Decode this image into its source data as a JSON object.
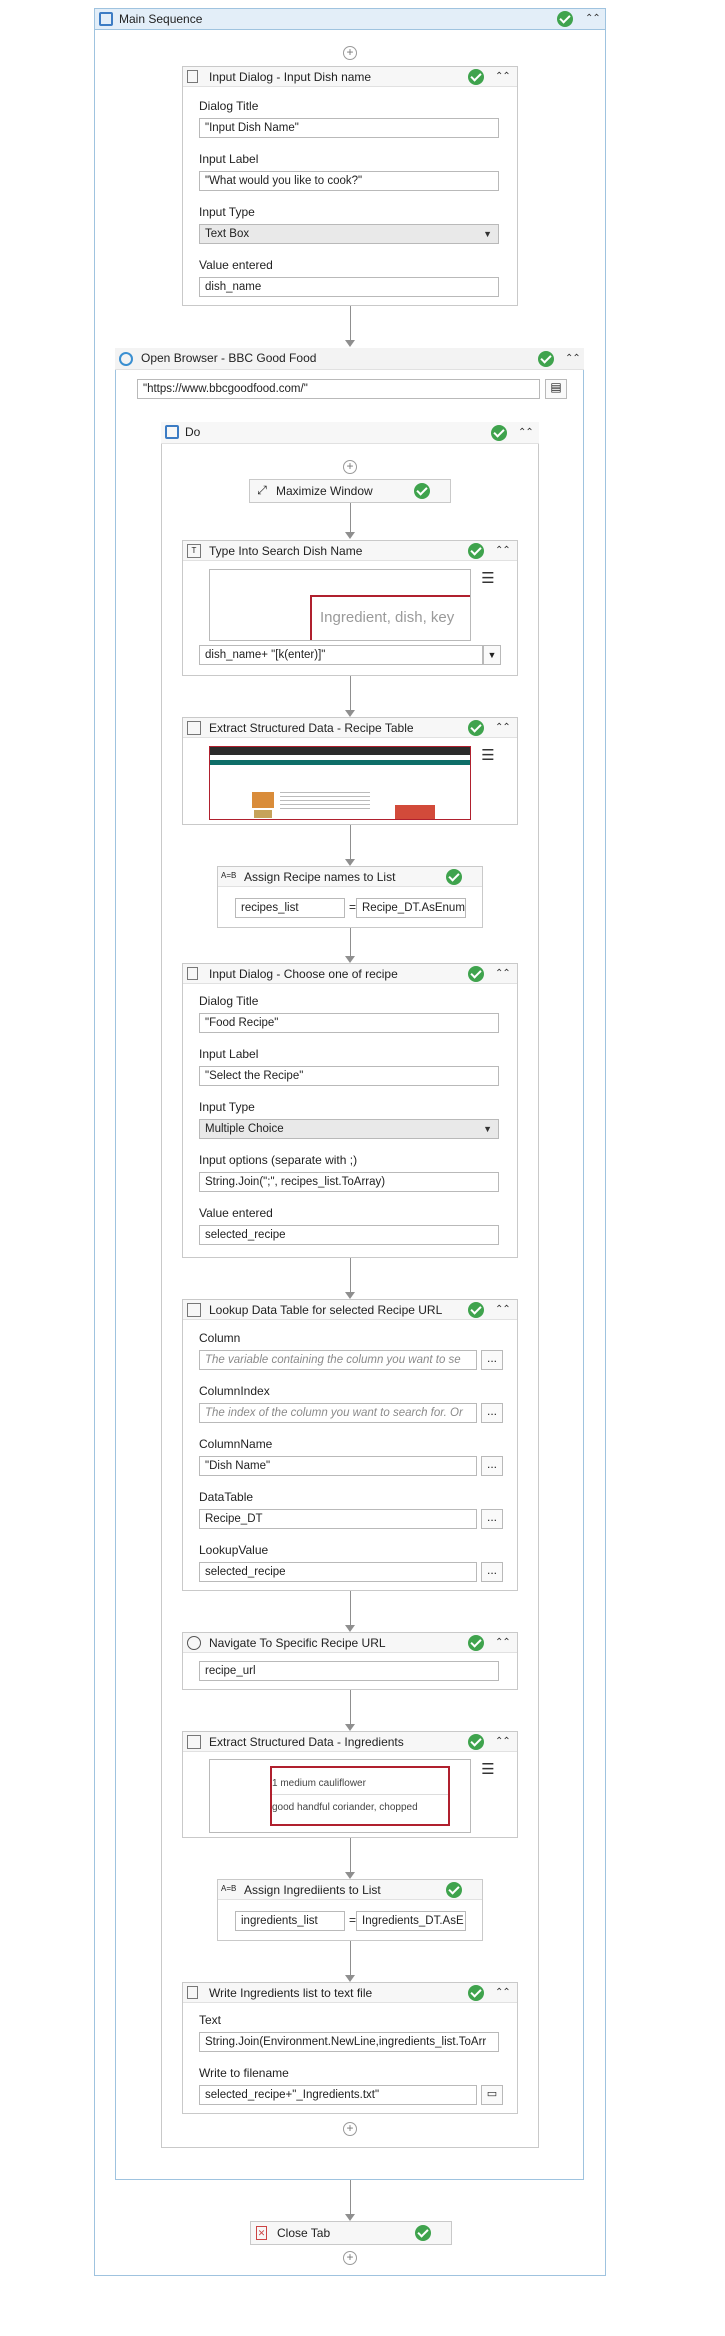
{
  "main_sequence": {
    "title": "Main Sequence"
  },
  "input_dish": {
    "title": "Input Dialog - Input Dish name",
    "dialog_title_label": "Dialog Title",
    "dialog_title_value": "\"Input Dish Name\"",
    "input_label_label": "Input Label",
    "input_label_value": "\"What would you like to cook?\"",
    "input_type_label": "Input Type",
    "input_type_value": "Text Box",
    "value_entered_label": "Value entered",
    "value_entered_value": "dish_name"
  },
  "open_browser": {
    "title": "Open Browser - BBC Good Food",
    "url": "\"https://www.bbcgoodfood.com/\""
  },
  "do_seq": {
    "title": "Do"
  },
  "maximize": {
    "title": "Maximize Window"
  },
  "type_into": {
    "title": "Type Into Search Dish Name",
    "preview_text": "Ingredient, dish, key",
    "text_value": "dish_name+ \"[k(enter)]\""
  },
  "extract_recipe": {
    "title": "Extract Structured Data - Recipe Table"
  },
  "assign_recipe": {
    "title": "Assign Recipe names to List",
    "left": "recipes_list",
    "eq": "=",
    "right": "Recipe_DT.AsEnum"
  },
  "input_recipe": {
    "title": "Input Dialog - Choose one of recipe",
    "dialog_title_label": "Dialog Title",
    "dialog_title_value": "\"Food Recipe\"",
    "input_label_label": "Input Label",
    "input_label_value": "\"Select the Recipe\"",
    "input_type_label": "Input Type",
    "input_type_value": "Multiple Choice",
    "options_label": "Input options (separate with ;)",
    "options_value": "String.Join(\";\", recipes_list.ToArray)",
    "value_entered_label": "Value entered",
    "value_entered_value": "selected_recipe"
  },
  "lookup": {
    "title": "Lookup Data Table for selected Recipe URL",
    "column_label": "Column",
    "column_ph": "The variable containing the column you want to se",
    "colindex_label": "ColumnIndex",
    "colindex_ph": "The index of the column you want to search for. Or",
    "colname_label": "ColumnName",
    "colname_value": "\"Dish Name\"",
    "datatable_label": "DataTable",
    "datatable_value": "Recipe_DT",
    "lookupvalue_label": "LookupValue",
    "lookupvalue_value": "selected_recipe",
    "dots": "..."
  },
  "navigate": {
    "title": "Navigate To Specific Recipe URL",
    "url": "recipe_url"
  },
  "extract_ingr": {
    "title": "Extract Structured Data - Ingredients",
    "line1": "1 medium cauliflower",
    "line2": "good handful coriander, chopped"
  },
  "assign_ingr": {
    "title": "Assign Ingrediients to List",
    "left": "ingredients_list",
    "eq": "=",
    "right": "Ingredients_DT.AsE"
  },
  "write_file": {
    "title": "Write Ingredients list to text file",
    "text_label": "Text",
    "text_value": "String.Join(Environment.NewLine,ingredients_list.ToArr",
    "filename_label": "Write to filename",
    "filename_value": "selected_recipe+\"_Ingredients.txt\""
  },
  "close_tab": {
    "title": "Close Tab"
  },
  "colors": {
    "accent_header": "#e3eef8",
    "border_blue": "#9fc3df",
    "success": "#3fa34d",
    "selection_red": "#b0202e"
  }
}
